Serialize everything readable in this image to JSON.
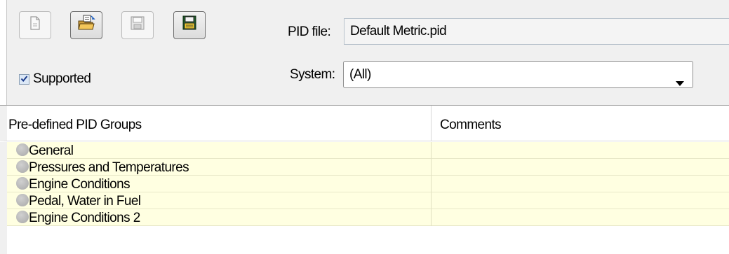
{
  "toolbar": {
    "buttons": [
      {
        "name": "new-file",
        "icon": "new-document-icon",
        "state": "disabled"
      },
      {
        "name": "open-file",
        "icon": "open-folder-icon",
        "state": "active"
      },
      {
        "name": "save-file",
        "icon": "save-disk-icon",
        "state": "disabled"
      },
      {
        "name": "save-as-file",
        "icon": "save-as-disk-icon",
        "state": "active"
      }
    ],
    "supported_label": "Supported",
    "supported_checked": true,
    "pid_file_label": "PID file:",
    "pid_file_value": "Default Metric.pid",
    "system_label": "System:",
    "system_value": "(All)",
    "dropdown_arrow": "▼"
  },
  "grid": {
    "columns": [
      "Pre-defined PID Groups",
      "Comments"
    ],
    "rows": [
      {
        "name": "General",
        "comment": ""
      },
      {
        "name": "Pressures and Temperatures",
        "comment": ""
      },
      {
        "name": "Engine Conditions",
        "comment": ""
      },
      {
        "name": "Pedal, Water in Fuel",
        "comment": ""
      },
      {
        "name": "Engine Conditions 2",
        "comment": ""
      }
    ]
  },
  "colors": {
    "row_background": "#ffffe1",
    "toolbar_background": "#f0f0f0",
    "status_dot": "#b0b0b0"
  }
}
